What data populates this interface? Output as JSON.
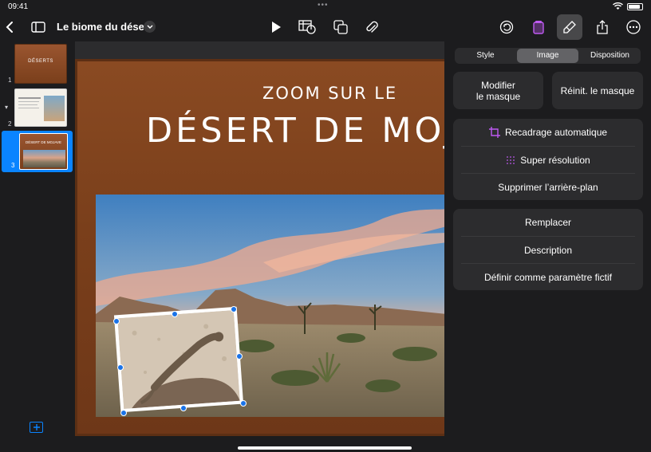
{
  "status": {
    "time": "09:41",
    "dots": "•••"
  },
  "toolbar": {
    "doc_title": "Le biome du désert",
    "icons": [
      "back-chevron-icon",
      "sidebar-icon",
      "play-icon",
      "table-chart-icon",
      "shapes-icon",
      "attachment-icon",
      "undo-icon",
      "document-icon",
      "format-paintbrush-icon",
      "share-icon",
      "more-icon"
    ],
    "accent": "#bf5af2"
  },
  "slides": [
    {
      "number": "1",
      "title": "DÉSERTS"
    },
    {
      "number": "2"
    },
    {
      "number": "3",
      "title": "DÉSERT DE MOJAVE",
      "selected": true
    }
  ],
  "slide": {
    "subtitle": "ZOOM SUR LE",
    "title": "DÉSERT DE MOJAVE"
  },
  "inspector": {
    "tabs": [
      "Style",
      "Image",
      "Disposition"
    ],
    "active_tab": "Image",
    "edit_mask": "Modifier\nle masque",
    "reset_mask": "Réinit. le masque",
    "group1": [
      "Recadrage automatique",
      "Super résolution",
      "Supprimer l’arrière-plan"
    ],
    "group2": [
      "Remplacer",
      "Description",
      "Définir comme paramètre fictif"
    ]
  },
  "colors": {
    "selection": "#0a84ff",
    "panel": "#2c2c2e",
    "slide_bg": "#7a3f1b"
  }
}
